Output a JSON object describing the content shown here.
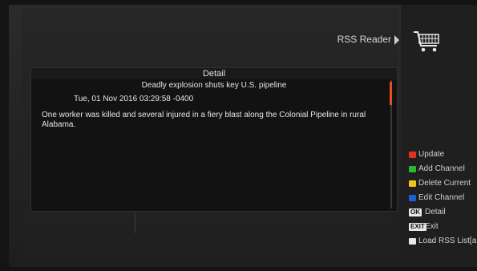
{
  "header": {
    "app_title": "RSS Reader",
    "app_icon": "shopping-cart-icon"
  },
  "detail": {
    "header": "Detail",
    "article_title": "Deadly explosion shuts key U.S. pipeline",
    "date": "Tue, 01 Nov 2016 03:29:58 -0400",
    "body": "One worker was killed and several injured in a fiery blast along the Colonial Pipeline in rural Alabama."
  },
  "legend": {
    "update": "Update",
    "add_channel": "Add Channel",
    "delete_current": "Delete Current",
    "edit_channel": "Edit Channel",
    "ok_key": "OK",
    "ok_label": "Detail",
    "exit_key": "EXIT",
    "exit_label": "Exit",
    "load_list": "Load RSS List[a"
  },
  "colors": {
    "red": "#e0301e",
    "green": "#2fb52f",
    "yellow": "#f0c419",
    "blue": "#1f5fd6",
    "white": "#e8e8e8",
    "scroll_accent": "#e2511f"
  }
}
